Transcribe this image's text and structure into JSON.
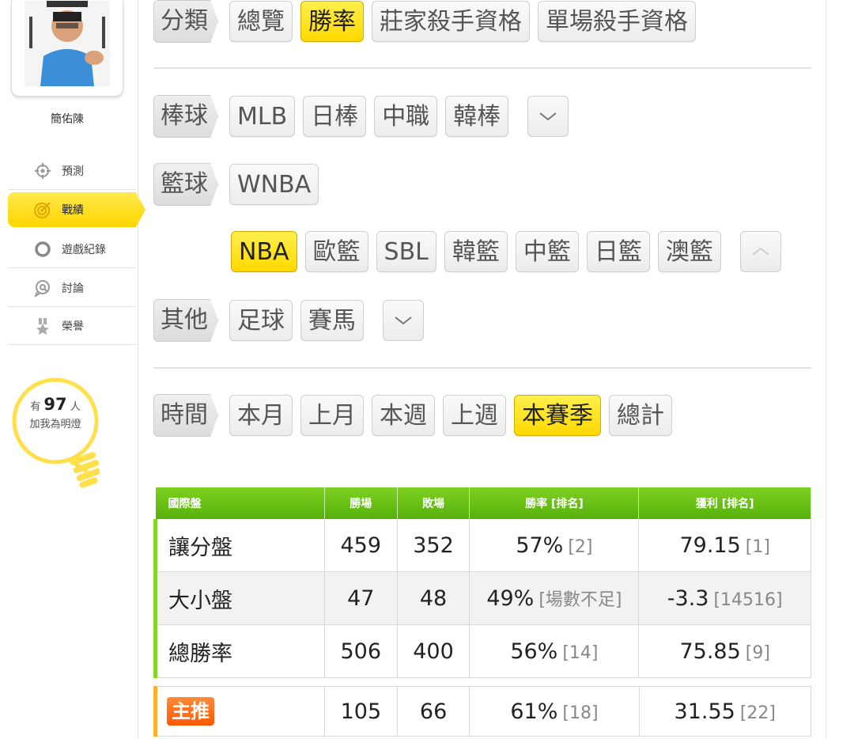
{
  "sidebar": {
    "user_name": "簡佑陳",
    "nav": [
      {
        "label": "預測",
        "icon": "crosshair-icon"
      },
      {
        "label": "戰績",
        "icon": "target-icon",
        "active": true
      },
      {
        "label": "遊戲紀錄",
        "icon": "circle-icon"
      },
      {
        "label": "討論",
        "icon": "chat-search-icon"
      },
      {
        "label": "榮譽",
        "icon": "medal-icon"
      }
    ],
    "fans": {
      "prefix": "有",
      "count": "97",
      "suffix": "人",
      "line2": "加我為明燈"
    }
  },
  "category": {
    "tag": "分類",
    "options": [
      "總覽",
      "勝率",
      "莊家殺手資格",
      "單場殺手資格"
    ],
    "selected": 1
  },
  "baseball": {
    "tag": "棒球",
    "options": [
      "MLB",
      "日棒",
      "中職",
      "韓棒"
    ]
  },
  "basketball": {
    "tag": "籃球",
    "options": [
      "WNBA"
    ],
    "expanded_options": [
      "NBA",
      "歐籃",
      "SBL",
      "韓籃",
      "中籃",
      "日籃",
      "澳籃"
    ],
    "selected": 0
  },
  "other": {
    "tag": "其他",
    "options": [
      "足球",
      "賽馬"
    ]
  },
  "time": {
    "tag": "時間",
    "options": [
      "本月",
      "上月",
      "本週",
      "上週",
      "本賽季",
      "總計"
    ],
    "selected": 4
  },
  "stats_table": {
    "headers": [
      "國際盤",
      "勝場",
      "敗場",
      "勝率 [排名]",
      "獲利 [排名]"
    ],
    "rows": [
      {
        "name": "讓分盤",
        "wins": "459",
        "losses": "352",
        "rate": "57%",
        "rate_rank": "[2]",
        "profit": "79.15",
        "profit_rank": "[1]"
      },
      {
        "name": "大小盤",
        "wins": "47",
        "losses": "48",
        "rate": "49%",
        "rate_rank": "[場數不足]",
        "profit": "-3.3",
        "profit_rank": "[14516]"
      },
      {
        "name": "總勝率",
        "wins": "506",
        "losses": "400",
        "rate": "56%",
        "rate_rank": "[14]",
        "profit": "75.85",
        "profit_rank": "[9]"
      }
    ],
    "featured": {
      "name": "主推",
      "wins": "105",
      "losses": "66",
      "rate": "61%",
      "rate_rank": "[18]",
      "profit": "31.55",
      "profit_rank": "[22]"
    }
  }
}
